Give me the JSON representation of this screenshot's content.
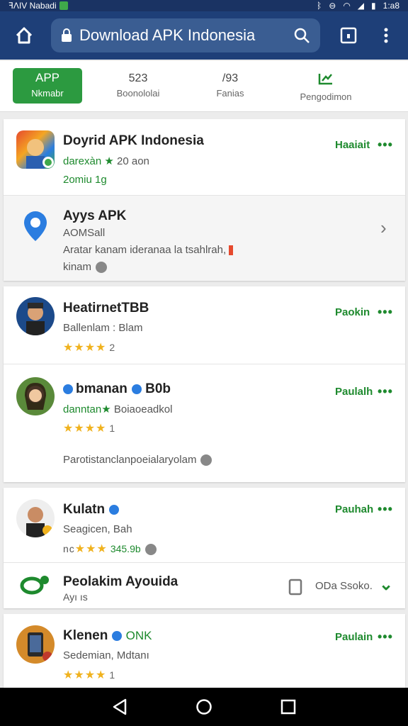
{
  "status_bar": {
    "left_text": "ꟻΛIV Nabadi",
    "time": "1:a8"
  },
  "browser": {
    "url_title": "Download APK Indonesia"
  },
  "tabs": [
    {
      "num": "APP",
      "label": "Nkmabr",
      "active": true
    },
    {
      "num": "523",
      "label": "Boonololai",
      "active": false
    },
    {
      "num": "/93",
      "label": "Fanias",
      "active": false
    },
    {
      "num": "",
      "label": "Pengodimon",
      "active": false
    }
  ],
  "items": [
    {
      "name": "Doyrid APK Indonesia",
      "sub1": "darexàn",
      "sub1b": "20 aon",
      "sub2": "2omiu 1g",
      "action": "Haaiait",
      "dots": "•••"
    },
    {
      "name": "Ayys APK",
      "sub1": "AOMSall",
      "sub2": "Aratar kanam ideranaa la tsahlrah,",
      "sub3": "kinam",
      "chevron": "›"
    },
    {
      "name": "HeatirnetTBB",
      "sub1": "Ballenlam : Blam",
      "stars": "★★★★",
      "count": "2",
      "action": "Paokin",
      "dots": "•••"
    },
    {
      "name": "bmanan",
      "name_suffix": "B0b",
      "sub1": "danntan",
      "sub1b": "Boiaoeadkol",
      "stars": "★★★★",
      "count": "1",
      "action": "Paulalh",
      "dots": "•••",
      "extra": "Parotistanclanpoeialaryolam"
    },
    {
      "name": "Kulatn",
      "sub1": "Seagicen, Bah",
      "sub2": "nc",
      "stars": "★★★",
      "count": "345.9b",
      "action": "Pauhah",
      "dots": "•••"
    },
    {
      "name": "Peolakim Ayouida",
      "sub1": "Ayı ıs",
      "right_text": "ODa Ssoko.",
      "chevron": "⌄"
    },
    {
      "name": "Klenen",
      "name_suffix": "ONK",
      "sub1": "Sedemian, Mdtanı",
      "stars": "★★★★",
      "count": "1",
      "action": "Paulain",
      "dots": "•••"
    }
  ],
  "colors": {
    "status_bar": "#1a3363",
    "top_bar": "#1e3f78",
    "accent_green": "#2c9a40",
    "star": "#f0b21e"
  }
}
